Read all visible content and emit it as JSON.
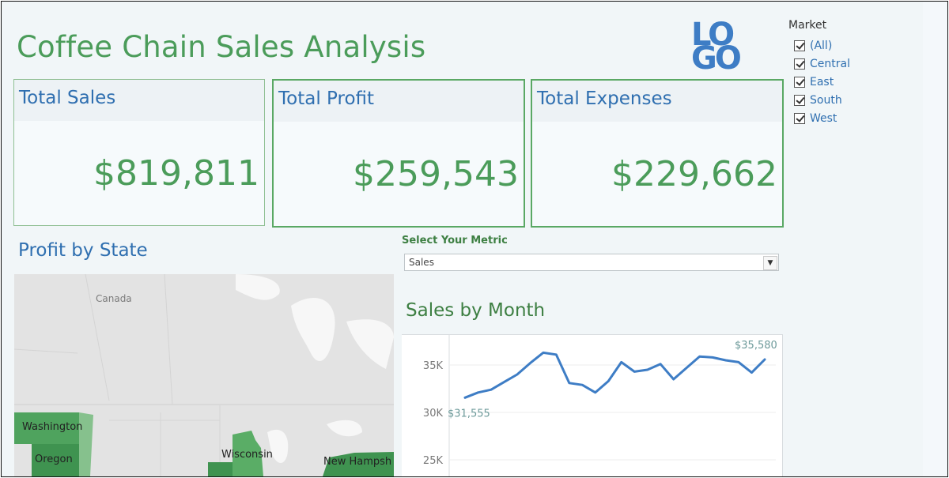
{
  "dashboard": {
    "title": "Coffee Chain Sales Analysis",
    "logo_text": "LOGO",
    "logo_row_1": "LO",
    "logo_row_2": "GO",
    "accent_green": "#4b9c5a",
    "accent_blue": "#2f6fb0"
  },
  "kpis": [
    {
      "label": "Total Sales",
      "value": "$819,811"
    },
    {
      "label": "Total Profit",
      "value": "$259,543"
    },
    {
      "label": "Total Expenses",
      "value": "$229,662"
    }
  ],
  "market_filter": {
    "title": "Market",
    "options": [
      {
        "label": "(All)",
        "checked": true
      },
      {
        "label": "Central",
        "checked": true
      },
      {
        "label": "East",
        "checked": true
      },
      {
        "label": "South",
        "checked": true
      },
      {
        "label": "West",
        "checked": true
      }
    ]
  },
  "map": {
    "title": "Profit by State",
    "labels": {
      "canada": "Canada",
      "washington": "Washington",
      "oregon": "Oregon",
      "wisconsin": "Wisconsin",
      "new_hampshire": "New Hampsh"
    }
  },
  "metric_selector": {
    "label": "Select Your Metric",
    "value": "Sales"
  },
  "chart_data": {
    "type": "line",
    "title": "Sales by Month",
    "xlabel": "",
    "ylabel": "",
    "y_tick_labels": [
      "35K",
      "30K",
      "25K"
    ],
    "y_ticks": [
      35000,
      30000,
      25000
    ],
    "ylim": [
      21000,
      38000
    ],
    "grid": true,
    "series": [
      {
        "values": [
          31555,
          32100,
          32400,
          33200,
          34000,
          35200,
          36300,
          36100,
          33100,
          32900,
          32100,
          33300,
          35300,
          34300,
          34500,
          35100,
          33500,
          34700,
          35900,
          35800,
          35500,
          35300,
          34200,
          35580
        ]
      }
    ],
    "data_labels": [
      {
        "index": 0,
        "text": "$31,555"
      },
      {
        "index": 23,
        "text": "$35,580"
      }
    ],
    "line_color": "#3e7dc5"
  }
}
